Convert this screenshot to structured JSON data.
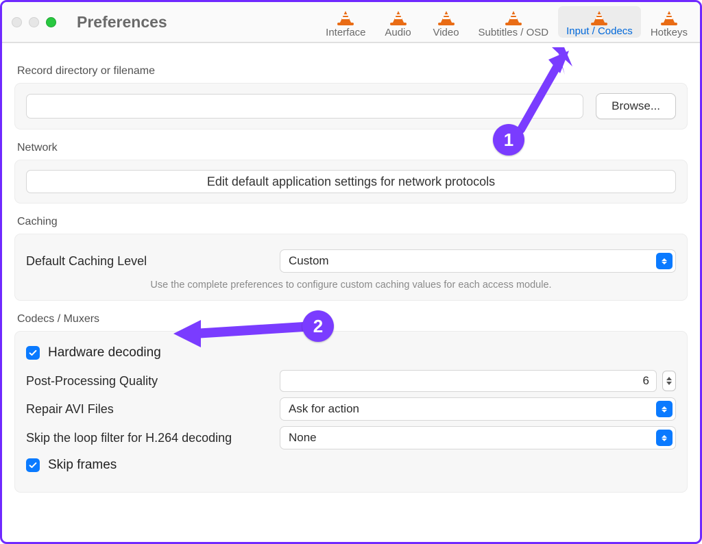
{
  "window": {
    "title": "Preferences"
  },
  "tabs": {
    "interface": "Interface",
    "audio": "Audio",
    "video": "Video",
    "subtitles": "Subtitles / OSD",
    "input_codecs": "Input / Codecs",
    "hotkeys": "Hotkeys"
  },
  "sections": {
    "record": {
      "label": "Record directory or filename",
      "value": "",
      "browse": "Browse..."
    },
    "network": {
      "label": "Network",
      "button": "Edit default application settings for network protocols"
    },
    "caching": {
      "label": "Caching",
      "level_label": "Default Caching Level",
      "level_value": "Custom",
      "hint": "Use the complete preferences to configure custom caching values for each access module."
    },
    "codecs": {
      "label": "Codecs / Muxers",
      "hw_decoding": "Hardware decoding",
      "postproc_label": "Post-Processing Quality",
      "postproc_value": "6",
      "repair_label": "Repair AVI Files",
      "repair_value": "Ask for action",
      "skiploop_label": "Skip the loop filter for H.264 decoding",
      "skiploop_value": "None",
      "skipframes": "Skip frames"
    }
  },
  "annotations": {
    "n1": "1",
    "n2": "2"
  }
}
